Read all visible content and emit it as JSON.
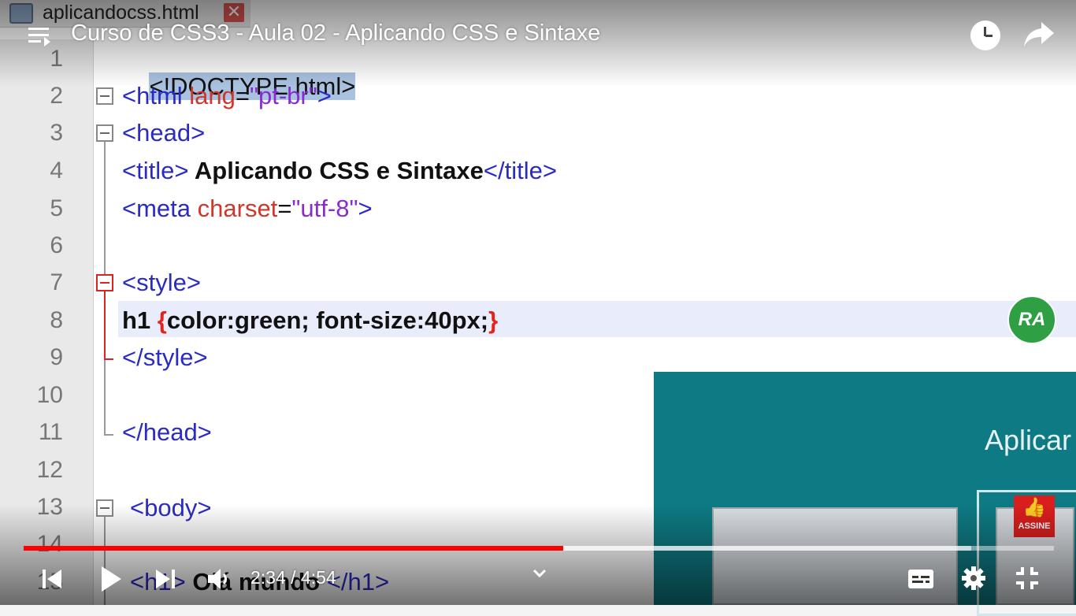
{
  "editor": {
    "file_tab": "aplicandocss.html",
    "close_glyph": "✕",
    "line_numbers": [
      "1",
      "2",
      "3",
      "4",
      "5",
      "6",
      "7",
      "8",
      "9",
      "10",
      "11",
      "12",
      "13",
      "14",
      "15"
    ],
    "lines": {
      "l1": "<!DOCTYPE html>",
      "l2_open": "<html ",
      "l2_attr": "lang",
      "l2_eq": "=",
      "l2_str": "\"pt-br\"",
      "l2_close": ">",
      "l3": "<head>",
      "l4_open": "<title>",
      "l4_text": " Aplicando CSS e Sintaxe",
      "l4_close": "</title>",
      "l5_open": "<meta ",
      "l5_attr": "charset",
      "l5_eq": "=",
      "l5_str": "\"utf-8\"",
      "l5_close": ">",
      "l7": "<style>",
      "l8_sel": "h1 ",
      "l8_lb": "{",
      "l8_body": "color:green; font-size:40px;",
      "l8_rb": "}",
      "l9": "</style>",
      "l11": "</head>",
      "l13": "<body>",
      "l15_open": "<h1>",
      "l15_text": " Olá mundo ",
      "l15_close": "</h1>"
    }
  },
  "slide": {
    "title": "Aplicar"
  },
  "channel": {
    "logo_text": "RA",
    "subscribe_label": "ASSINE"
  },
  "player": {
    "title": "Curso de CSS3 - Aula 02 - Aplicando CSS e Sintaxe",
    "current_time": "2:34",
    "duration": "4:54",
    "time_display": "2:34 / 4:54",
    "played_fraction": 0.524,
    "buffered_fraction": 0.92,
    "accent_color": "#ff0000"
  },
  "icons": {
    "menu": "playlist-icon",
    "watch_later": "clock-icon",
    "share": "share-icon",
    "prev": "previous-icon",
    "play": "play-icon",
    "next": "next-icon",
    "volume": "volume-icon",
    "captions": "captions-icon",
    "settings": "gear-icon",
    "exit_fullscreen": "exit-fullscreen-icon"
  }
}
